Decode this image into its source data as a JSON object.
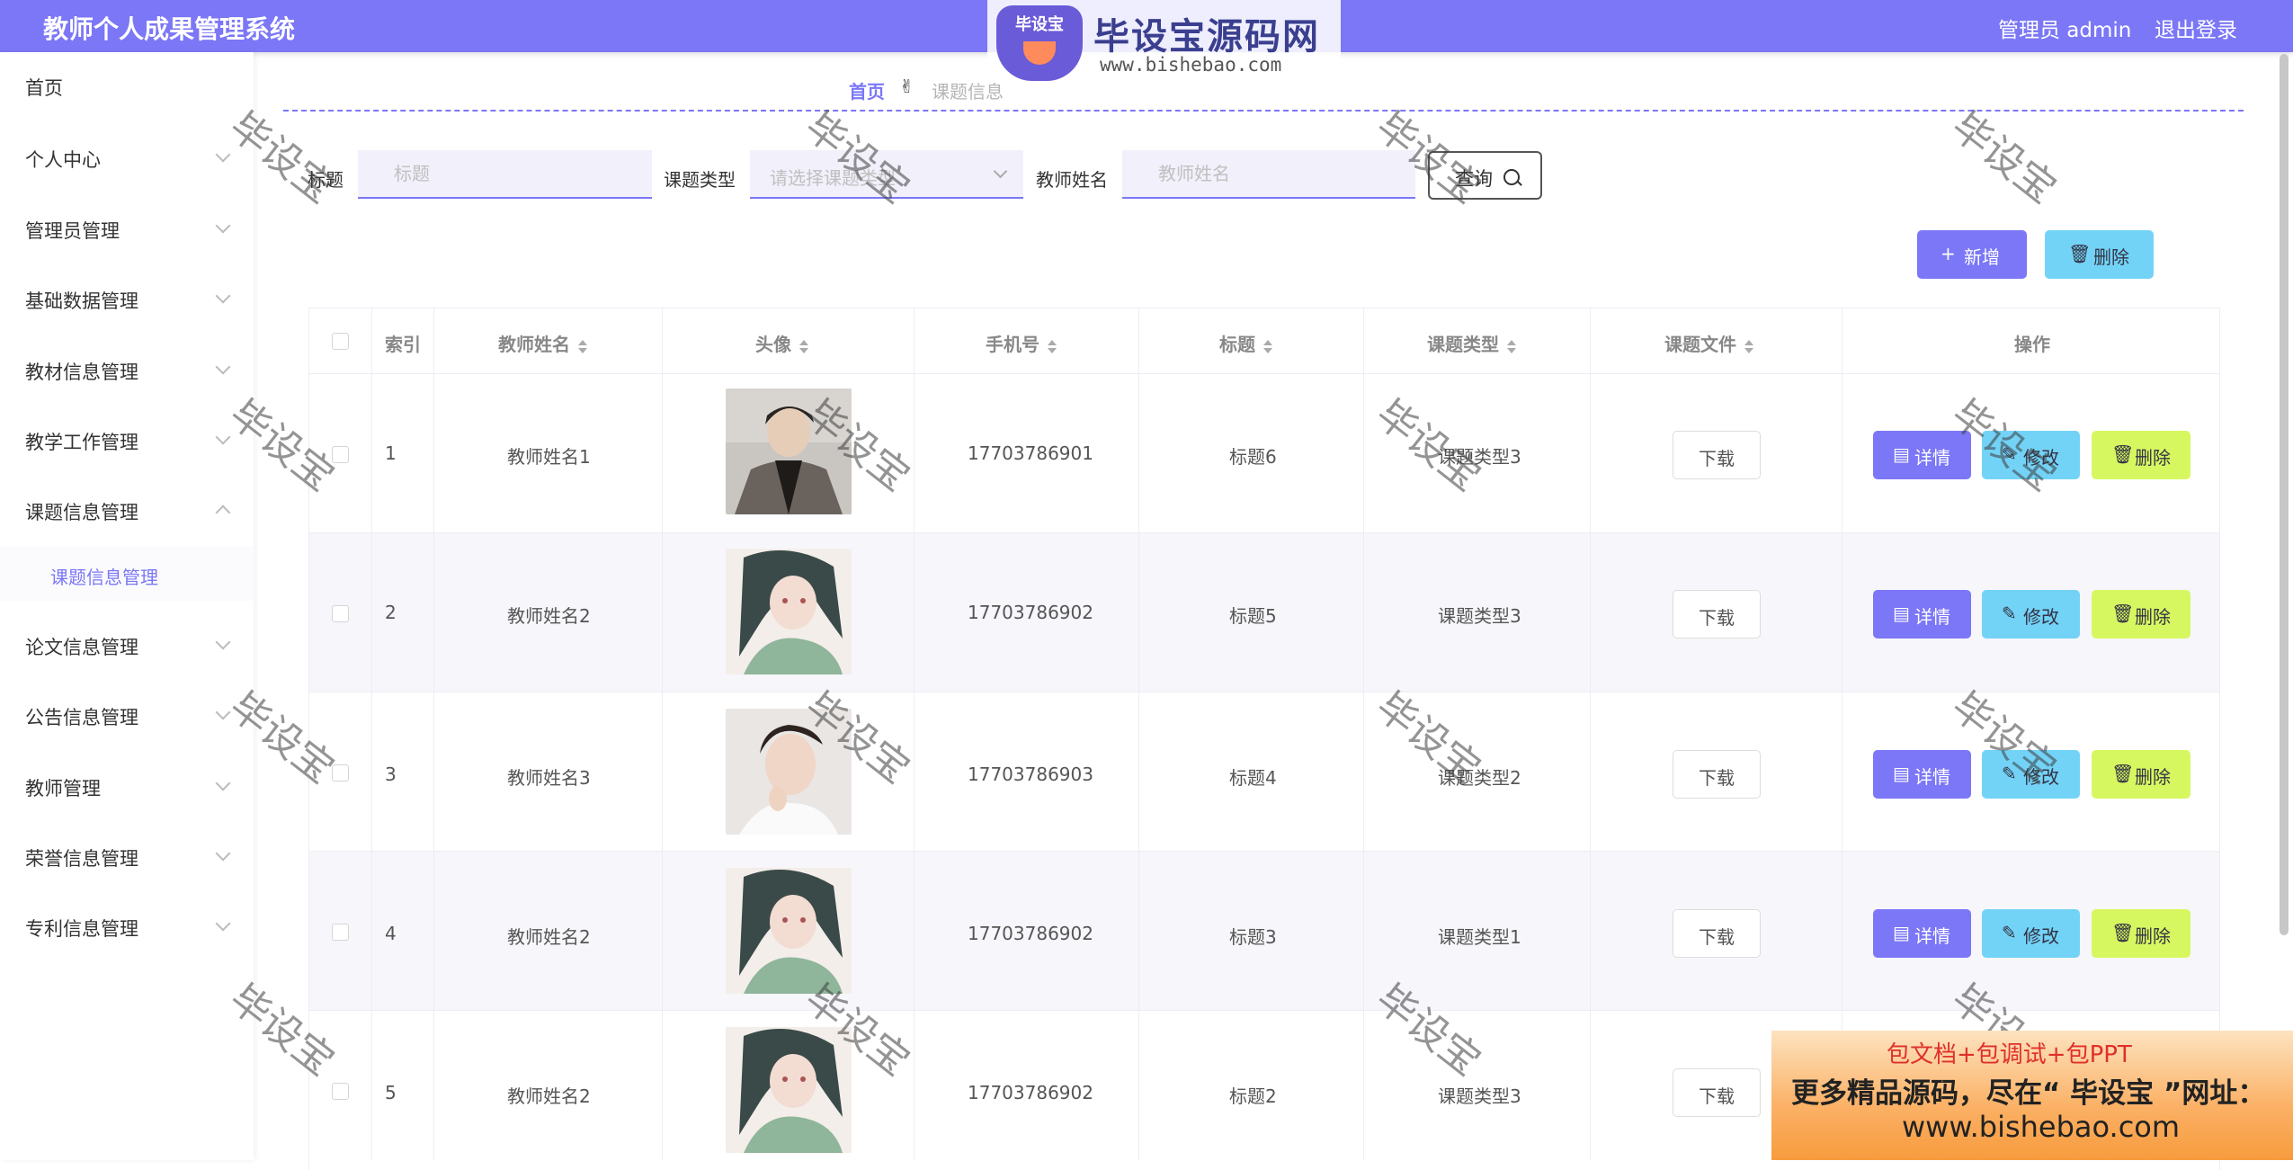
{
  "header": {
    "app_title": "教师个人成果管理系统",
    "admin_label": "管理员 admin",
    "logout_label": "退出登录"
  },
  "logo": {
    "badge_text": "毕设宝",
    "title": "毕设宝源码网",
    "url": "www.bishebao.com"
  },
  "sidebar": {
    "items": [
      {
        "label": "首页"
      },
      {
        "label": "个人中心"
      },
      {
        "label": "管理员管理"
      },
      {
        "label": "基础数据管理"
      },
      {
        "label": "教材信息管理"
      },
      {
        "label": "教学工作管理"
      },
      {
        "label": "课题信息管理"
      },
      {
        "label": "论文信息管理"
      },
      {
        "label": "公告信息管理"
      },
      {
        "label": "教师管理"
      },
      {
        "label": "荣誉信息管理"
      },
      {
        "label": "专利信息管理"
      }
    ],
    "active_sub": "课题信息管理"
  },
  "breadcrumb": {
    "home": "首页",
    "separator": "✌",
    "current": "课题信息"
  },
  "search": {
    "title_label": "标题",
    "title_placeholder": "标题",
    "type_label": "课题类型",
    "type_placeholder": "请选择课题类型",
    "teacher_label": "教师姓名",
    "teacher_placeholder": "教师姓名",
    "search_button": "查询"
  },
  "toolbar": {
    "add_label": "新增",
    "delete_label": "删除"
  },
  "table": {
    "headers": {
      "index": "索引",
      "teacher_name": "教师姓名",
      "avatar": "头像",
      "phone": "手机号",
      "title": "标题",
      "type": "课题类型",
      "file": "课题文件",
      "actions": "操作"
    },
    "rows": [
      {
        "index": "1",
        "teacher_name": "教师姓名1",
        "phone": "17703786901",
        "title": "标题6",
        "type": "课题类型3"
      },
      {
        "index": "2",
        "teacher_name": "教师姓名2",
        "phone": "17703786902",
        "title": "标题5",
        "type": "课题类型3"
      },
      {
        "index": "3",
        "teacher_name": "教师姓名3",
        "phone": "17703786903",
        "title": "标题4",
        "type": "课题类型2"
      },
      {
        "index": "4",
        "teacher_name": "教师姓名2",
        "phone": "17703786902",
        "title": "标题3",
        "type": "课题类型1"
      },
      {
        "index": "5",
        "teacher_name": "教师姓名2",
        "phone": "17703786902",
        "title": "标题2",
        "type": "课题类型3"
      }
    ],
    "download_label": "下载",
    "detail_label": "详情",
    "edit_label": "修改",
    "delete_label": "删除"
  },
  "watermark_text": "毕设宝",
  "promo": {
    "line1": "包文档+包调试+包PPT",
    "line2": "更多精品源码，尽在“ 毕设宝 ”网址：",
    "line3": "www.bishebao.com"
  },
  "colors": {
    "primary": "#7b77f6",
    "info": "#73d3f7",
    "danger_lime": "#d7f761",
    "promo_orange": "#f79b3d"
  }
}
